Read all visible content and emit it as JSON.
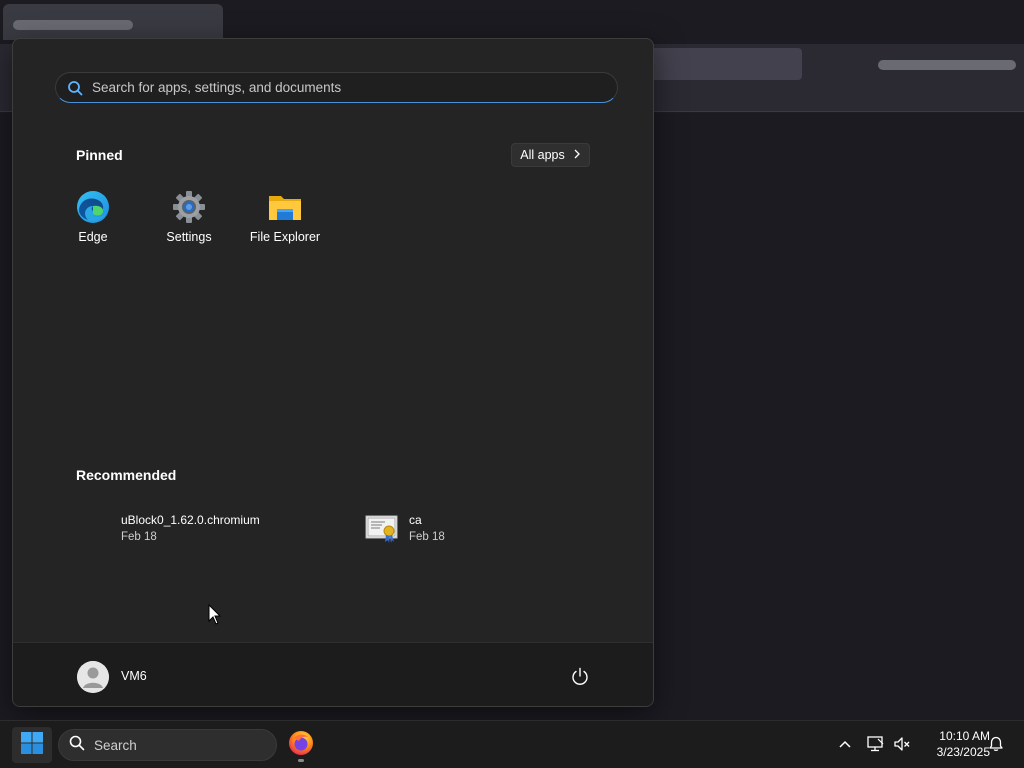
{
  "start_menu": {
    "search_placeholder": "Search for apps, settings, and documents",
    "pinned_title": "Pinned",
    "all_apps_label": "All apps",
    "pinned_apps": [
      {
        "label": "Edge",
        "icon": "edge-icon"
      },
      {
        "label": "Settings",
        "icon": "settings-gear-icon"
      },
      {
        "label": "File Explorer",
        "icon": "folder-icon"
      }
    ],
    "recommended_title": "Recommended",
    "recommended": [
      {
        "name": "uBlock0_1.62.0.chromium",
        "date": "Feb 18",
        "icon": "folder-icon"
      },
      {
        "name": "ca",
        "date": "Feb 18",
        "icon": "certificate-icon"
      }
    ],
    "user": {
      "name": "VM6",
      "icon": "user-avatar-icon"
    },
    "power_icon": "power-icon"
  },
  "taskbar": {
    "search_label": "Search",
    "start_icon": "windows-logo-icon",
    "apps": [
      {
        "name": "Firefox",
        "icon": "firefox-icon",
        "running": true
      }
    ],
    "tray_icons": [
      "chevron-up-icon",
      "network-icon",
      "volume-muted-icon",
      "notification-bell-icon"
    ],
    "time": "10:10 AM",
    "date": "3/23/2025"
  },
  "colors": {
    "accent": "#4a90d9",
    "menu_bg": "#242424",
    "taskbar_bg": "#1c1c1c"
  }
}
